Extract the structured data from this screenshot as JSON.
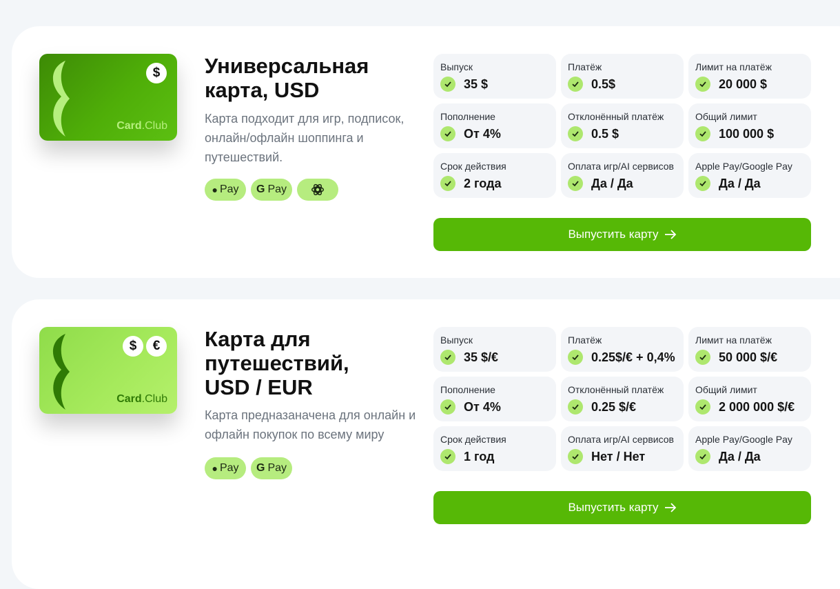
{
  "colors": {
    "accent": "#56b806",
    "check_bg": "#aee76e",
    "badge_bg": "#b6ec7f"
  },
  "products": [
    {
      "brand": {
        "card": "Card",
        "club": ".Club"
      },
      "currency_icons": [
        "$"
      ],
      "title_lines": [
        "Универсальная",
        "карта, USD"
      ],
      "description_lines": [
        "Карта подходит для игр, подписок,",
        "онлайн/офлайн шоппинга и",
        "путешествий."
      ],
      "badges": [
        {
          "icon": "apple-icon",
          "label": "Pay"
        },
        {
          "icon": "google-icon",
          "label": "Pay"
        },
        {
          "icon": "openai-icon",
          "label": ""
        }
      ],
      "specs": [
        {
          "label": "Выпуск",
          "value": "35 $"
        },
        {
          "label": "Платёж",
          "value": "0.5$"
        },
        {
          "label": "Лимит на платёж",
          "value": "20 000 $"
        },
        {
          "label": "Пополнение",
          "value": "От 4%"
        },
        {
          "label": "Отклонённый платёж",
          "value": "0.5 $"
        },
        {
          "label": "Общий лимит",
          "value": "100 000 $"
        },
        {
          "label": "Срок действия",
          "value": "2 года"
        },
        {
          "label": "Оплата игр/AI сервисов",
          "value": "Да / Да"
        },
        {
          "label": "Apple Pay/Google Pay",
          "value": "Да / Да"
        }
      ],
      "cta": "Выпустить карту"
    },
    {
      "brand": {
        "card": "Card",
        "club": ".Club"
      },
      "currency_icons": [
        "$",
        "€"
      ],
      "title_lines": [
        "Карта для",
        "путешествий,",
        "USD / EUR"
      ],
      "description_lines": [
        "Карта предназаначена для онлайн и",
        "офлайн покупок по всему миру"
      ],
      "badges": [
        {
          "icon": "apple-icon",
          "label": "Pay"
        },
        {
          "icon": "google-icon",
          "label": "Pay"
        }
      ],
      "specs": [
        {
          "label": "Выпуск",
          "value": "35 $/€"
        },
        {
          "label": "Платёж",
          "value": "0.25$/€ + 0,4%"
        },
        {
          "label": "Лимит на платёж",
          "value": "50 000 $/€"
        },
        {
          "label": "Пополнение",
          "value": "От 4%"
        },
        {
          "label": "Отклонённый платёж",
          "value": "0.25 $/€"
        },
        {
          "label": "Общий лимит",
          "value": "2 000 000 $/€"
        },
        {
          "label": "Срок действия",
          "value": "1 год"
        },
        {
          "label": "Оплата игр/AI сервисов",
          "value": "Нет / Нет"
        },
        {
          "label": "Apple Pay/Google Pay",
          "value": "Да / Да"
        }
      ],
      "cta": "Выпустить карту"
    }
  ]
}
